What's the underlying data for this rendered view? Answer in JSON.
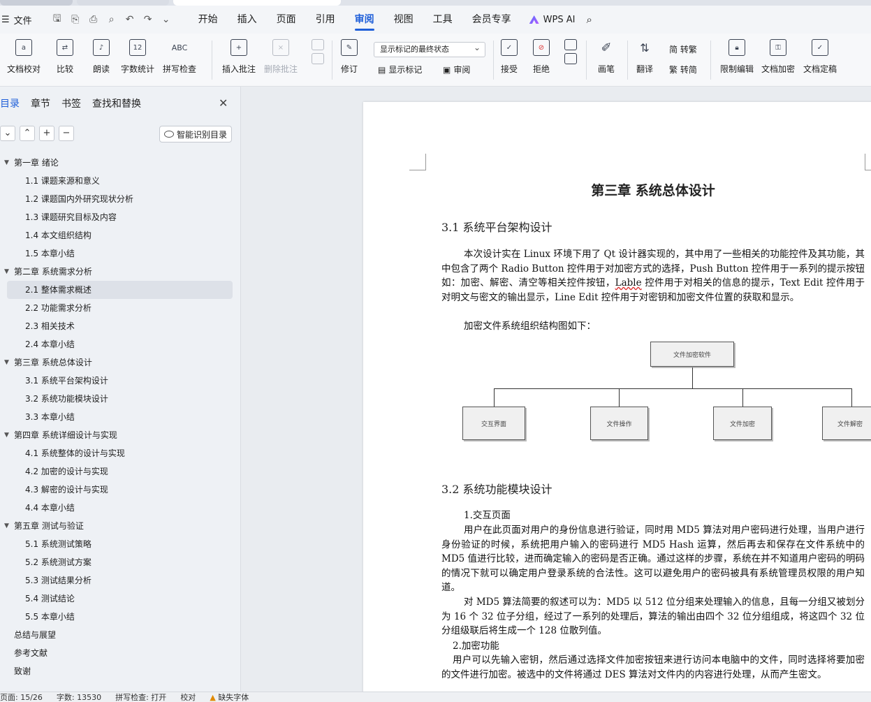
{
  "menubar": {
    "file_label": "文件",
    "menus": [
      "开始",
      "插入",
      "页面",
      "引用",
      "审阅",
      "视图",
      "工具",
      "会员专享"
    ],
    "active_menu": "审阅",
    "wps_ai": "WPS AI"
  },
  "ribbon": {
    "doc_check": "文档校对",
    "compare": "比较",
    "read_aloud": "朗读",
    "word_count": "字数统计",
    "spell_check": "拼写检查",
    "insert_comment": "插入批注",
    "delete_comment": "删除批注",
    "revise": "修订",
    "markup_select": "显示标记的最终状态",
    "show_markup": "显示标记",
    "review": "审阅",
    "accept": "接受",
    "reject": "拒绝",
    "pen": "画笔",
    "translate": "翻译",
    "to_traditional": "简 转繁",
    "to_simplified": "繁 转简",
    "restrict_edit": "限制编辑",
    "doc_encrypt": "文档加密",
    "doc_final": "文档定稿",
    "word_count_icon": "12",
    "spell_icon": "ABC"
  },
  "nav": {
    "tabs": [
      "目录",
      "章节",
      "书签",
      "查找和替换"
    ],
    "smart_toc": "智能识别目录",
    "toc": [
      {
        "level": 1,
        "text": "第一章  绪论",
        "expand": true
      },
      {
        "level": 2,
        "text": "1.1  课题来源和意义"
      },
      {
        "level": 2,
        "text": "1.2  课题国内外研究现状分析"
      },
      {
        "level": 2,
        "text": "1.3  课题研究目标及内容"
      },
      {
        "level": 2,
        "text": "1.4  本文组织结构"
      },
      {
        "level": 2,
        "text": "1.5 本章小结"
      },
      {
        "level": 1,
        "text": "第二章  系统需求分析",
        "expand": true
      },
      {
        "level": 2,
        "text": "2.1  整体需求概述",
        "selected": true
      },
      {
        "level": 2,
        "text": "2.2  功能需求分析"
      },
      {
        "level": 2,
        "text": "2.3  相关技术"
      },
      {
        "level": 2,
        "text": "2.4  本章小结"
      },
      {
        "level": 1,
        "text": "第三章  系统总体设计",
        "expand": true
      },
      {
        "level": 2,
        "text": "3.1 系统平台架构设计"
      },
      {
        "level": 2,
        "text": "3.2  系统功能模块设计"
      },
      {
        "level": 2,
        "text": "3.3  本章小结"
      },
      {
        "level": 1,
        "text": "第四章  系统详细设计与实现",
        "expand": true
      },
      {
        "level": 2,
        "text": "4.1 系统整体的设计与实现"
      },
      {
        "level": 2,
        "text": "4.2  加密的设计与实现"
      },
      {
        "level": 2,
        "text": "4.3  解密的设计与实现"
      },
      {
        "level": 2,
        "text": "4.4  本章小结"
      },
      {
        "level": 1,
        "text": "第五章  测试与验证",
        "expand": true
      },
      {
        "level": 2,
        "text": "5.1  系统测试策略"
      },
      {
        "level": 2,
        "text": "5.2  系统测试方案"
      },
      {
        "level": 2,
        "text": "5.3  测试结果分析"
      },
      {
        "level": 2,
        "text": "5.4  测试结论"
      },
      {
        "level": 2,
        "text": "5.5  本章小结"
      },
      {
        "level": 1,
        "text": "总结与展望"
      },
      {
        "level": 1,
        "text": "参考文献"
      },
      {
        "level": 1,
        "text": "致谢"
      }
    ]
  },
  "doc": {
    "chapter_title": "第三章  系统总体设计",
    "sec1_title": "3.1 系统平台架构设计",
    "sec1_p1_a": "本次设计实在 Linux 环境下用了 Qt 设计器实现的，其中用了一些相关的功能控件及其功能，其中包含了两个 Radio Button 控件用于对加密方式的选择，Push Button 控件用于一系列的提示按钮如：加密、解密、清空等相关控件按钮，",
    "sec1_p1_wavy": "Lable",
    "sec1_p1_b": " 控件用于对相关的信息的提示，Text Edit 控件用于对明文与密文的输出显示，Line Edit 控件用于对密钥和加密文件位置的获取和显示。",
    "sec1_p2": "加密文件系统组织结构图如下：",
    "org_root": "文件加密软件",
    "org_children": [
      "交互界面",
      "文件操作",
      "文件加密",
      "文件解密"
    ],
    "sec2_title": "3.2  系统功能模块设计",
    "item1_title": "1.交互页面",
    "item1_p1": "用户在此页面对用户的身份信息进行验证，同时用 MD5 算法对用户密码进行处理，当用户进行身份验证的时候，系统把用户输入的密码进行 MD5 Hash 运算，然后再去和保存在文件系统中的 MD5 值进行比较，进而确定输入的密码是否正确。通过这样的步骤，系统在并不知道用户密码的明码的情况下就可以确定用户登录系统的合法性。这可以避免用户的密码被具有系统管理员权限的用户知道。",
    "item1_p2": "对 MD5 算法简要的叙述可以为：MD5 以 512 位分组来处理输入的信息，且每一分组又被划分为 16 个 32 位子分组，经过了一系列的处理后，算法的输出由四个 32 位分组组成，将这四个 32 位分组级联后将生成一个 128 位散列值。",
    "item2_title": "2.加密功能",
    "item2_p1": "用户可以先输入密钥，然后通过选择文件加密按钮来进行访问本电脑中的文件，同时选择将要加密的文件进行加密。被选中的文件将通过 DES 算法对文件内的内容进行处理，从而产生密文。"
  },
  "status": {
    "page": "页面: 15/26",
    "words": "字数: 13530",
    "spell": "拼写检查: 打开",
    "proof": "校对",
    "missing_font": "缺失字体"
  }
}
